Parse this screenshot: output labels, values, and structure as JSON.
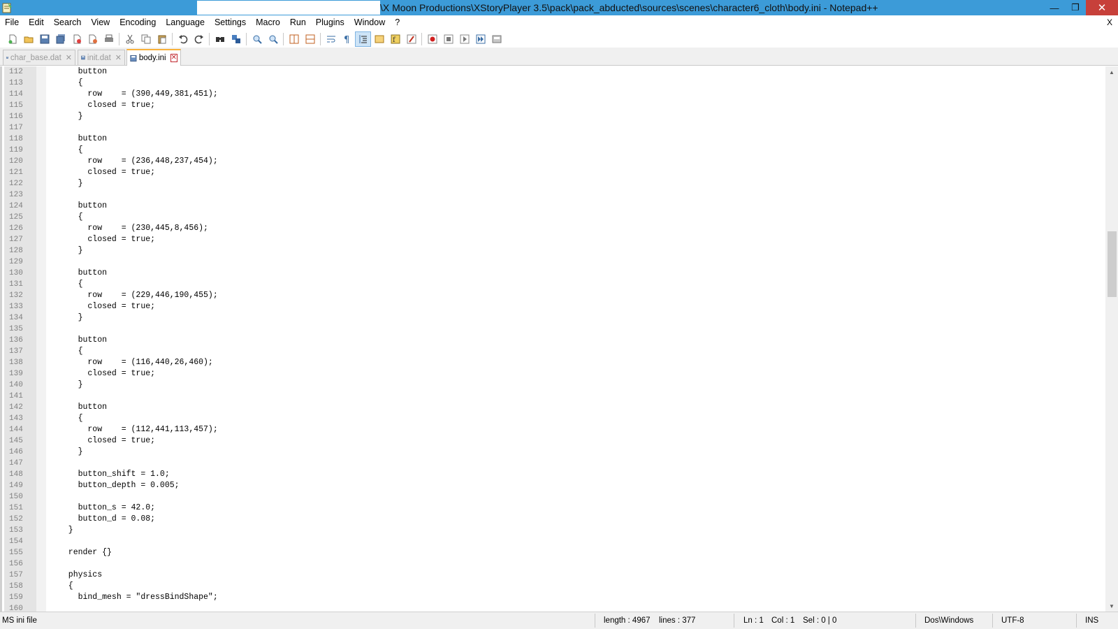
{
  "window": {
    "title": "\\X Moon Productions\\XStoryPlayer 3.5\\pack\\pack_abducted\\sources\\scenes\\character6_cloth\\body.ini - Notepad++",
    "minimize_glyph": "—",
    "restore_glyph": "❐",
    "close_glyph": "✕"
  },
  "menu": {
    "items": [
      "File",
      "Edit",
      "Search",
      "View",
      "Encoding",
      "Language",
      "Settings",
      "Macro",
      "Run",
      "Plugins",
      "Window",
      "?"
    ],
    "close_glyph": "X"
  },
  "toolbar": {
    "buttons": [
      "new-file-icon",
      "open-file-icon",
      "save-icon",
      "save-all-icon",
      "close-icon",
      "close-all-icon",
      "print-icon",
      "cut-icon",
      "copy-icon",
      "paste-icon",
      "undo-icon",
      "redo-icon",
      "find-icon",
      "replace-icon",
      "zoom-in-icon",
      "zoom-out-icon",
      "sync-vertical-icon",
      "sync-horizontal-icon",
      "word-wrap-icon",
      "show-all-chars-icon",
      "indent-guide-icon",
      "doc-map-icon",
      "function-list-icon",
      "folder-workspace-icon",
      "record-macro-icon",
      "stop-macro-icon",
      "play-macro-icon",
      "run-macro-multiple-icon",
      "save-macro-icon"
    ]
  },
  "tabs": [
    {
      "label": "char_base.dat",
      "active": false
    },
    {
      "label": "init.dat",
      "active": false
    },
    {
      "label": "body.ini",
      "active": true
    }
  ],
  "editor": {
    "lines": [
      {
        "n": "112",
        "t": "    button"
      },
      {
        "n": "113",
        "t": "    {"
      },
      {
        "n": "114",
        "t": "      row    = (390,449,381,451);"
      },
      {
        "n": "115",
        "t": "      closed = true;"
      },
      {
        "n": "116",
        "t": "    }"
      },
      {
        "n": "117",
        "t": ""
      },
      {
        "n": "118",
        "t": "    button"
      },
      {
        "n": "119",
        "t": "    {"
      },
      {
        "n": "120",
        "t": "      row    = (236,448,237,454);"
      },
      {
        "n": "121",
        "t": "      closed = true;"
      },
      {
        "n": "122",
        "t": "    }"
      },
      {
        "n": "123",
        "t": ""
      },
      {
        "n": "124",
        "t": "    button"
      },
      {
        "n": "125",
        "t": "    {"
      },
      {
        "n": "126",
        "t": "      row    = (230,445,8,456);"
      },
      {
        "n": "127",
        "t": "      closed = true;"
      },
      {
        "n": "128",
        "t": "    }"
      },
      {
        "n": "129",
        "t": ""
      },
      {
        "n": "130",
        "t": "    button"
      },
      {
        "n": "131",
        "t": "    {"
      },
      {
        "n": "132",
        "t": "      row    = (229,446,190,455);"
      },
      {
        "n": "133",
        "t": "      closed = true;"
      },
      {
        "n": "134",
        "t": "    }"
      },
      {
        "n": "135",
        "t": ""
      },
      {
        "n": "136",
        "t": "    button"
      },
      {
        "n": "137",
        "t": "    {"
      },
      {
        "n": "138",
        "t": "      row    = (116,440,26,460);"
      },
      {
        "n": "139",
        "t": "      closed = true;"
      },
      {
        "n": "140",
        "t": "    }"
      },
      {
        "n": "141",
        "t": ""
      },
      {
        "n": "142",
        "t": "    button"
      },
      {
        "n": "143",
        "t": "    {"
      },
      {
        "n": "144",
        "t": "      row    = (112,441,113,457);"
      },
      {
        "n": "145",
        "t": "      closed = true;"
      },
      {
        "n": "146",
        "t": "    }"
      },
      {
        "n": "147",
        "t": ""
      },
      {
        "n": "148",
        "t": "    button_shift = 1.0;"
      },
      {
        "n": "149",
        "t": "    button_depth = 0.005;"
      },
      {
        "n": "150",
        "t": ""
      },
      {
        "n": "151",
        "t": "    button_s = 42.0;"
      },
      {
        "n": "152",
        "t": "    button_d = 0.08;"
      },
      {
        "n": "153",
        "t": "  }"
      },
      {
        "n": "154",
        "t": ""
      },
      {
        "n": "155",
        "t": "  render {}"
      },
      {
        "n": "156",
        "t": ""
      },
      {
        "n": "157",
        "t": "  physics"
      },
      {
        "n": "158",
        "t": "  {"
      },
      {
        "n": "159",
        "t": "    bind_mesh = \"dressBindShape\";"
      },
      {
        "n": "160",
        "t": ""
      }
    ]
  },
  "scrollbar": {
    "up": "▲",
    "down": "▼"
  },
  "status": {
    "file_type": "MS ini file",
    "length": "length : 4967",
    "lines": "lines : 377",
    "ln": "Ln : 1",
    "col": "Col : 1",
    "sel": "Sel : 0 | 0",
    "eol": "Dos\\Windows",
    "encoding": "UTF-8",
    "mode": "INS"
  }
}
